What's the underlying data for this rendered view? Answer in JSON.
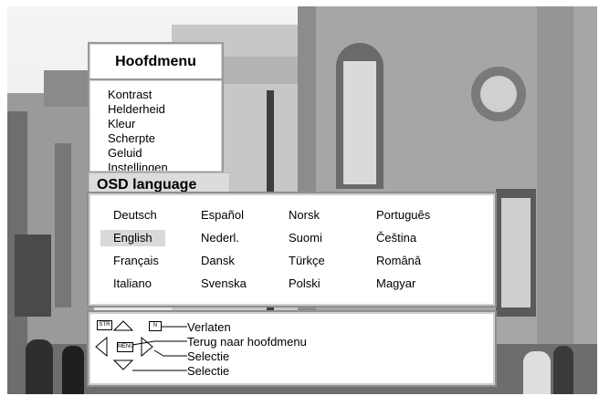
{
  "main_menu": {
    "title": "Hoofdmenu",
    "items": [
      "Kontrast",
      "Helderheid",
      "Kleur",
      "Scherpte",
      "Geluid",
      "Instellingen"
    ]
  },
  "osd_language": {
    "title": "OSD language",
    "selected": "English",
    "columns": [
      [
        "Deutsch",
        "English",
        "Français",
        "Italiano"
      ],
      [
        "Español",
        "Nederl.",
        "Dansk",
        "Svenska"
      ],
      [
        "Norsk",
        "Suomi",
        "Türkçe",
        "Polski"
      ],
      [
        "Português",
        "Čeština",
        "Românǎ",
        "Magyar"
      ]
    ]
  },
  "help": {
    "exit_label": "Verlaten",
    "back_label": "Terug naar hoofdmenu",
    "select_label_1": "Selectie",
    "select_label_2": "Selectie",
    "key_str": "STR",
    "key_menu": "MENU",
    "key_n": "N"
  }
}
